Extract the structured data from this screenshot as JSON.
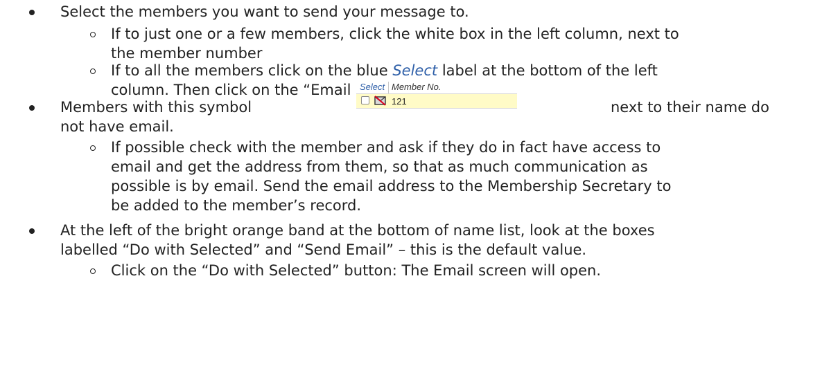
{
  "items": [
    {
      "text": "Select the members you want to send your message to.",
      "sub": [
        {
          "line1": "If to just one or a few members, click the white box in the left column, next to",
          "line2": "the member number"
        },
        {
          "line1_pre": "If to all the members click on the blue ",
          "line1_link": "Select",
          "line1_post": " label at the bottom of the left",
          "line2": "column.  Then click on the “Email Only” item on the list."
        }
      ]
    },
    {
      "line1_pre": "Members with this symbol",
      "line1_post": "next to their name do",
      "line2": "not have email.",
      "sub": [
        {
          "line1": "If possible check with the member and ask if they do in fact have access to",
          "line2": "email and get the address from them, so that as much communication as",
          "line3": "possible is by email.  Send the email address to the Membership Secretary to",
          "line4": "be added to the member’s record."
        }
      ]
    },
    {
      "line1": "At the left of the bright orange band at the bottom of name list, look at the boxes",
      "line2": "labelled “Do with Selected” and “Send Email” – this is the default value.",
      "sub": [
        {
          "line1": "Click on the “Do with Selected” button:  The Email screen will open."
        }
      ]
    }
  ],
  "mini_grid": {
    "header_select": "Select",
    "header_member": "Member No.",
    "row_member_no": "121",
    "icon": "no-email-icon",
    "link_color": "#2e5fa8",
    "row_color": "#fffbc7"
  }
}
